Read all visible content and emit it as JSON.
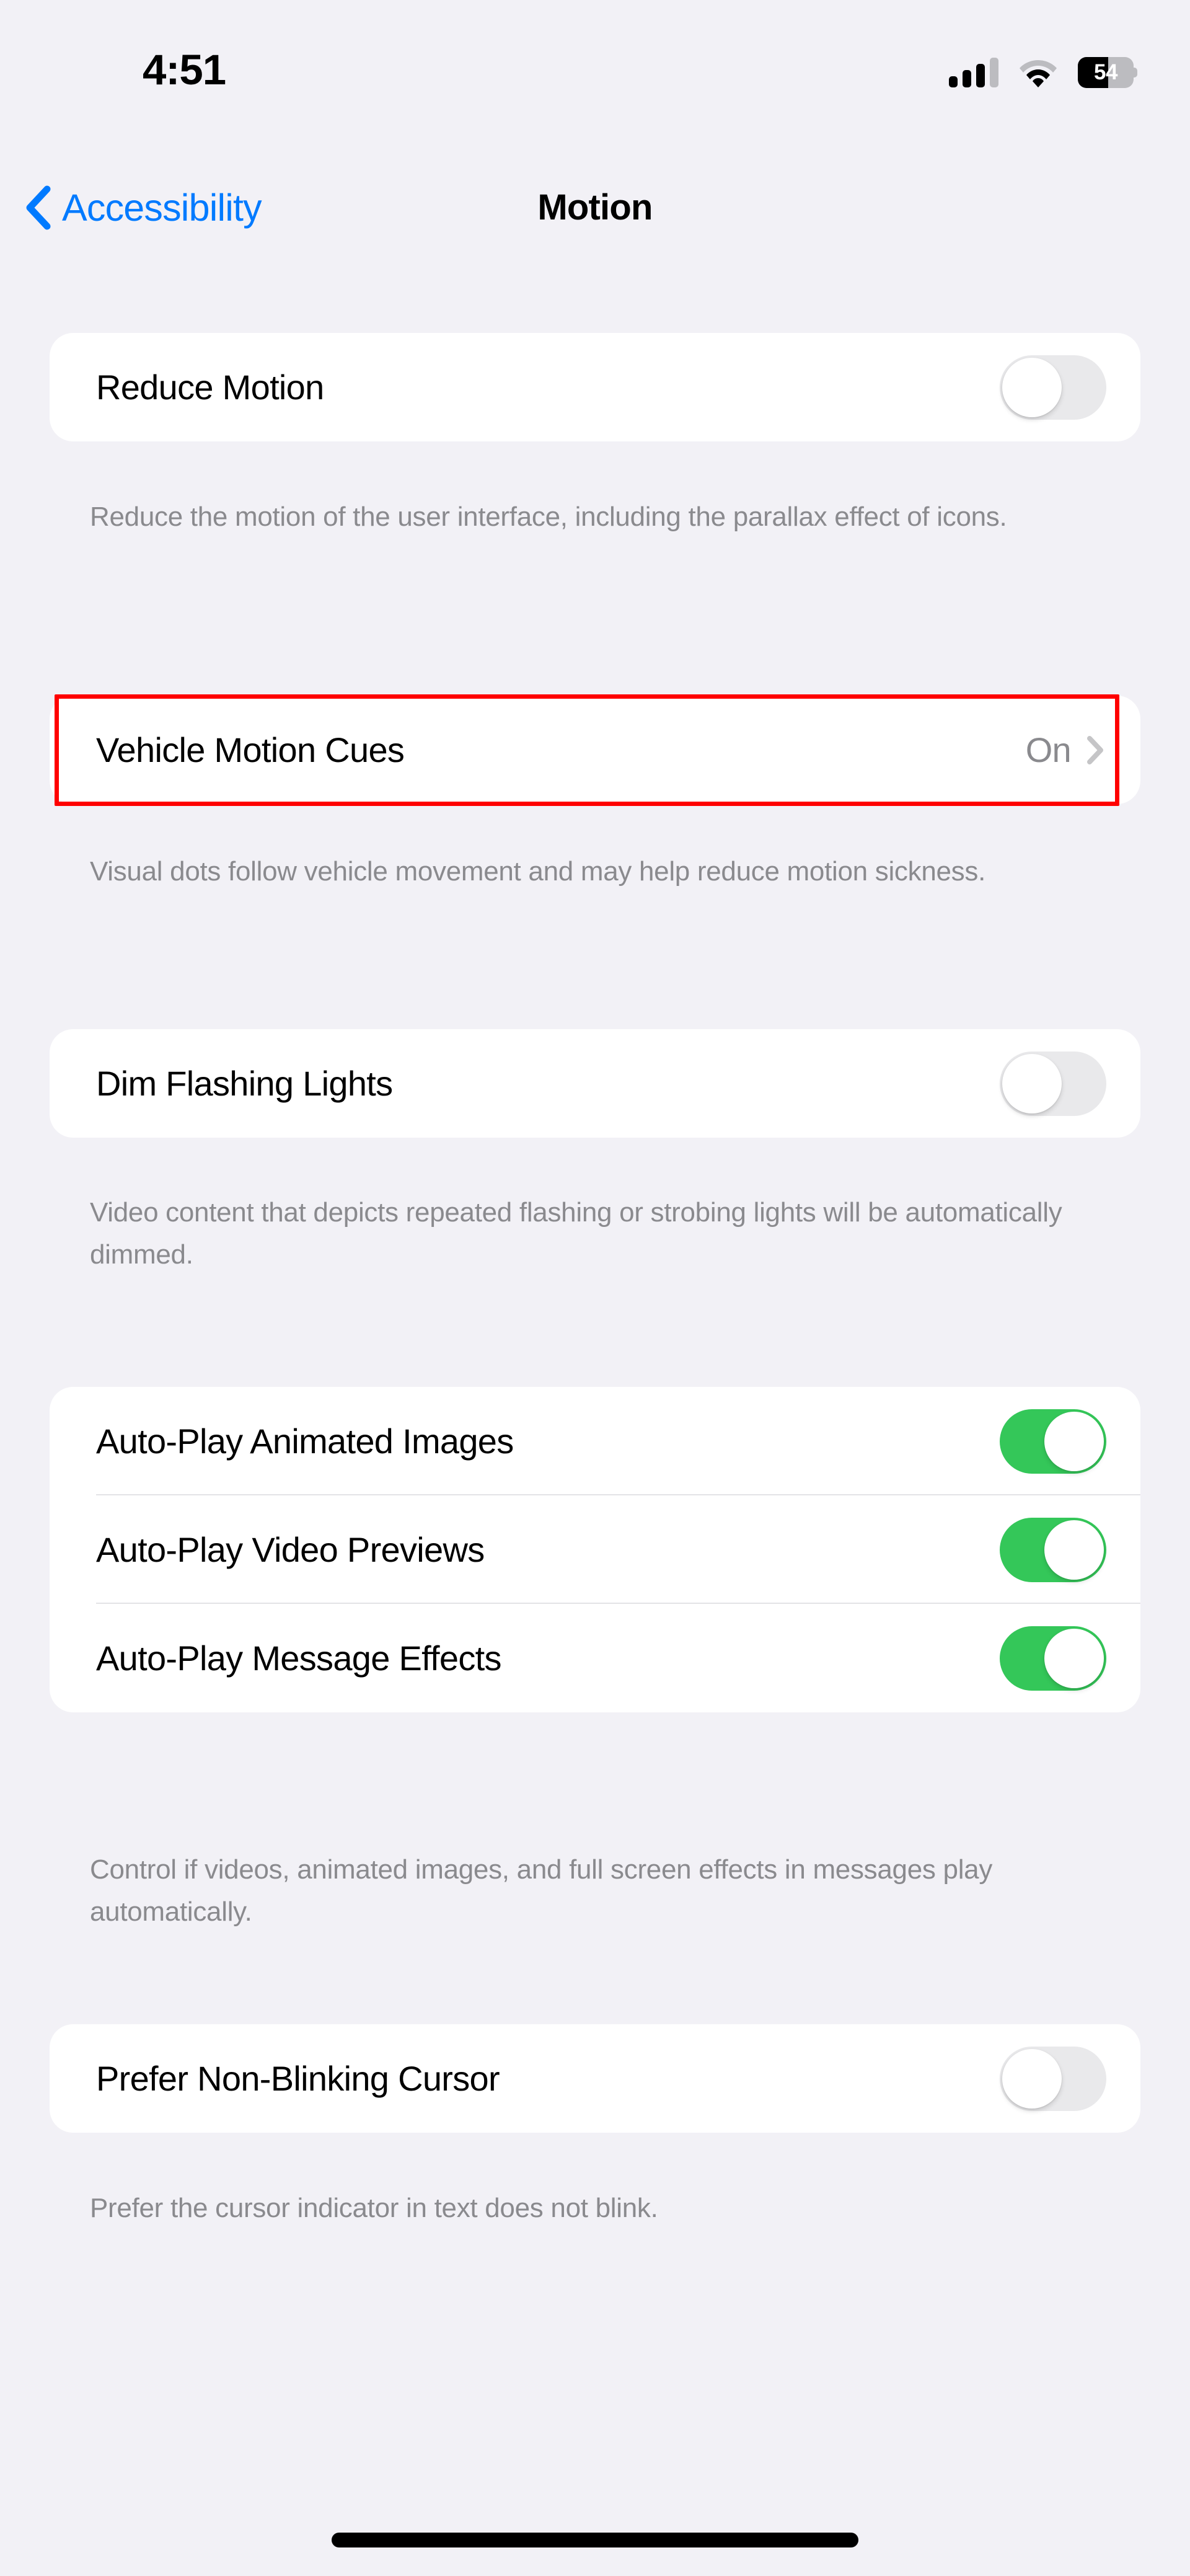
{
  "status_bar": {
    "time": "4:51",
    "cellular_icon": "cellular-signal-icon",
    "cellular_bars_filled": 3,
    "cellular_bars_total": 4,
    "wifi_icon": "wifi-icon",
    "battery_icon": "battery-icon",
    "battery_percent": "54",
    "battery_level": 54
  },
  "nav": {
    "back_label": "Accessibility",
    "back_icon": "chevron-left-icon",
    "title": "Motion"
  },
  "colors": {
    "accent_blue": "#007AFF",
    "toggle_on_green": "#34C759",
    "toggle_off_gray": "#E9E9EB",
    "highlight_red": "#FF0000",
    "page_background": "#F2F1F6",
    "card_background": "#FFFFFF",
    "secondary_text": "#8A8A8E"
  },
  "sections": [
    {
      "rows": [
        {
          "label": "Reduce Motion",
          "control": "toggle",
          "state": "off"
        }
      ],
      "footnote": "Reduce the motion of the user interface, including the parallax effect of icons."
    },
    {
      "rows": [
        {
          "label": "Vehicle Motion Cues",
          "control": "disclosure",
          "value": "On",
          "chevron_icon": "chevron-right-icon",
          "highlighted": true
        }
      ],
      "footnote": "Visual dots follow vehicle movement and may help reduce motion sickness."
    },
    {
      "rows": [
        {
          "label": "Dim Flashing Lights",
          "control": "toggle",
          "state": "off"
        }
      ],
      "footnote": "Video content that depicts repeated flashing or strobing lights will be automatically dimmed."
    },
    {
      "rows": [
        {
          "label": "Auto-Play Animated Images",
          "control": "toggle",
          "state": "on"
        },
        {
          "label": "Auto-Play Video Previews",
          "control": "toggle",
          "state": "on"
        },
        {
          "label": "Auto-Play Message Effects",
          "control": "toggle",
          "state": "on"
        }
      ],
      "footnote": "Control if videos, animated images, and full screen effects in messages play automatically."
    },
    {
      "rows": [
        {
          "label": "Prefer Non-Blinking Cursor",
          "control": "toggle",
          "state": "off"
        }
      ],
      "footnote": "Prefer the cursor indicator in text does not blink."
    }
  ],
  "home_indicator": "home-indicator"
}
